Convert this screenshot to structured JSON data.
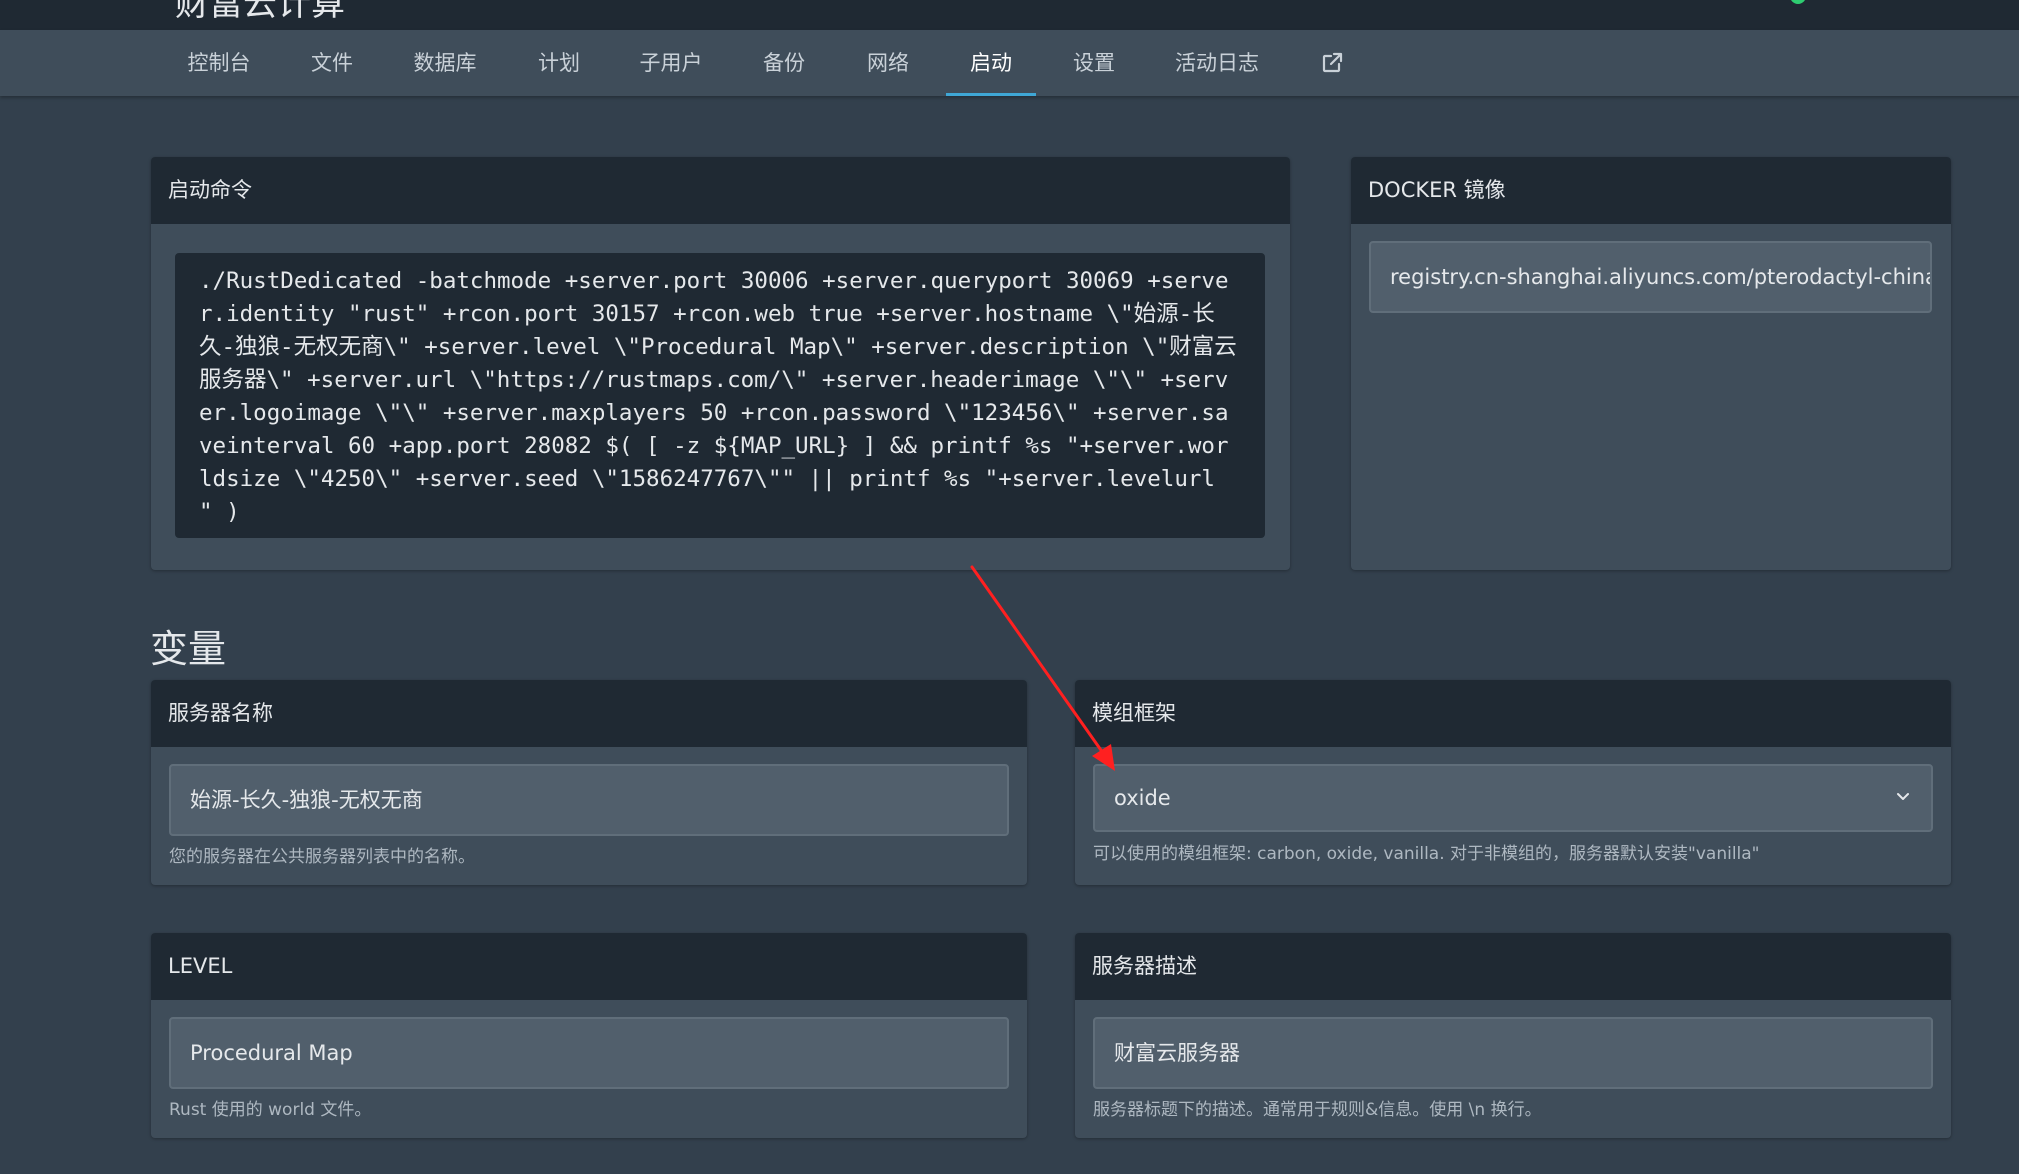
{
  "header": {
    "brand": "财富云计算"
  },
  "nav": {
    "tabs": [
      {
        "label": "控制台"
      },
      {
        "label": "文件"
      },
      {
        "label": "数据库"
      },
      {
        "label": "计划"
      },
      {
        "label": "子用户"
      },
      {
        "label": "备份"
      },
      {
        "label": "网络"
      },
      {
        "label": "启动",
        "active": true
      },
      {
        "label": "设置"
      },
      {
        "label": "活动日志"
      }
    ],
    "external_icon": "external-link-icon"
  },
  "startup": {
    "title": "启动命令",
    "command": "./RustDedicated -batchmode +server.port 30006 +server.queryport 30069 +server.identity \"rust\" +rcon.port 30157 +rcon.web true +server.hostname \\\"始源-长久-独狼-无权无商\\\" +server.level \\\"Procedural Map\\\" +server.description \\\"财富云服务器\\\" +server.url \\\"https://rustmaps.com/\\\" +server.headerimage \\\"\\\" +server.logoimage \\\"\\\" +server.maxplayers 50 +rcon.password \\\"123456\\\" +server.saveinterval 60 +app.port 28082 $( [ -z ${MAP_URL} ] && printf %s \"+server.worldsize \\\"4250\\\" +server.seed \\\"1586247767\\\"\" || printf %s \"+server.levelurl \" )"
  },
  "docker": {
    "title": "DOCKER 镜像",
    "value": "registry.cn-shanghai.aliyuncs.com/pterodactyl-china"
  },
  "variables": {
    "title": "变量",
    "server_name": {
      "title": "服务器名称",
      "value": "始源-长久-独狼-无权无商",
      "help": "您的服务器在公共服务器列表中的名称。"
    },
    "mod_framework": {
      "title": "模组框架",
      "value": "oxide",
      "help": "可以使用的模组框架: carbon, oxide, vanilla. 对于非模组的，服务器默认安装\"vanilla\""
    },
    "level": {
      "title": "LEVEL",
      "value": "Procedural Map",
      "help": "Rust 使用的 world 文件。"
    },
    "server_description": {
      "title": "服务器描述",
      "value": "财富云服务器",
      "help": "服务器标题下的描述。通常用于规则&信息。使用 \\n 换行。"
    }
  },
  "colors": {
    "background": "#33404d",
    "card": "#3f4d5a",
    "header": "#1f2933",
    "accent": "#3fa7d6",
    "annotation_arrow": "#ff2020"
  }
}
